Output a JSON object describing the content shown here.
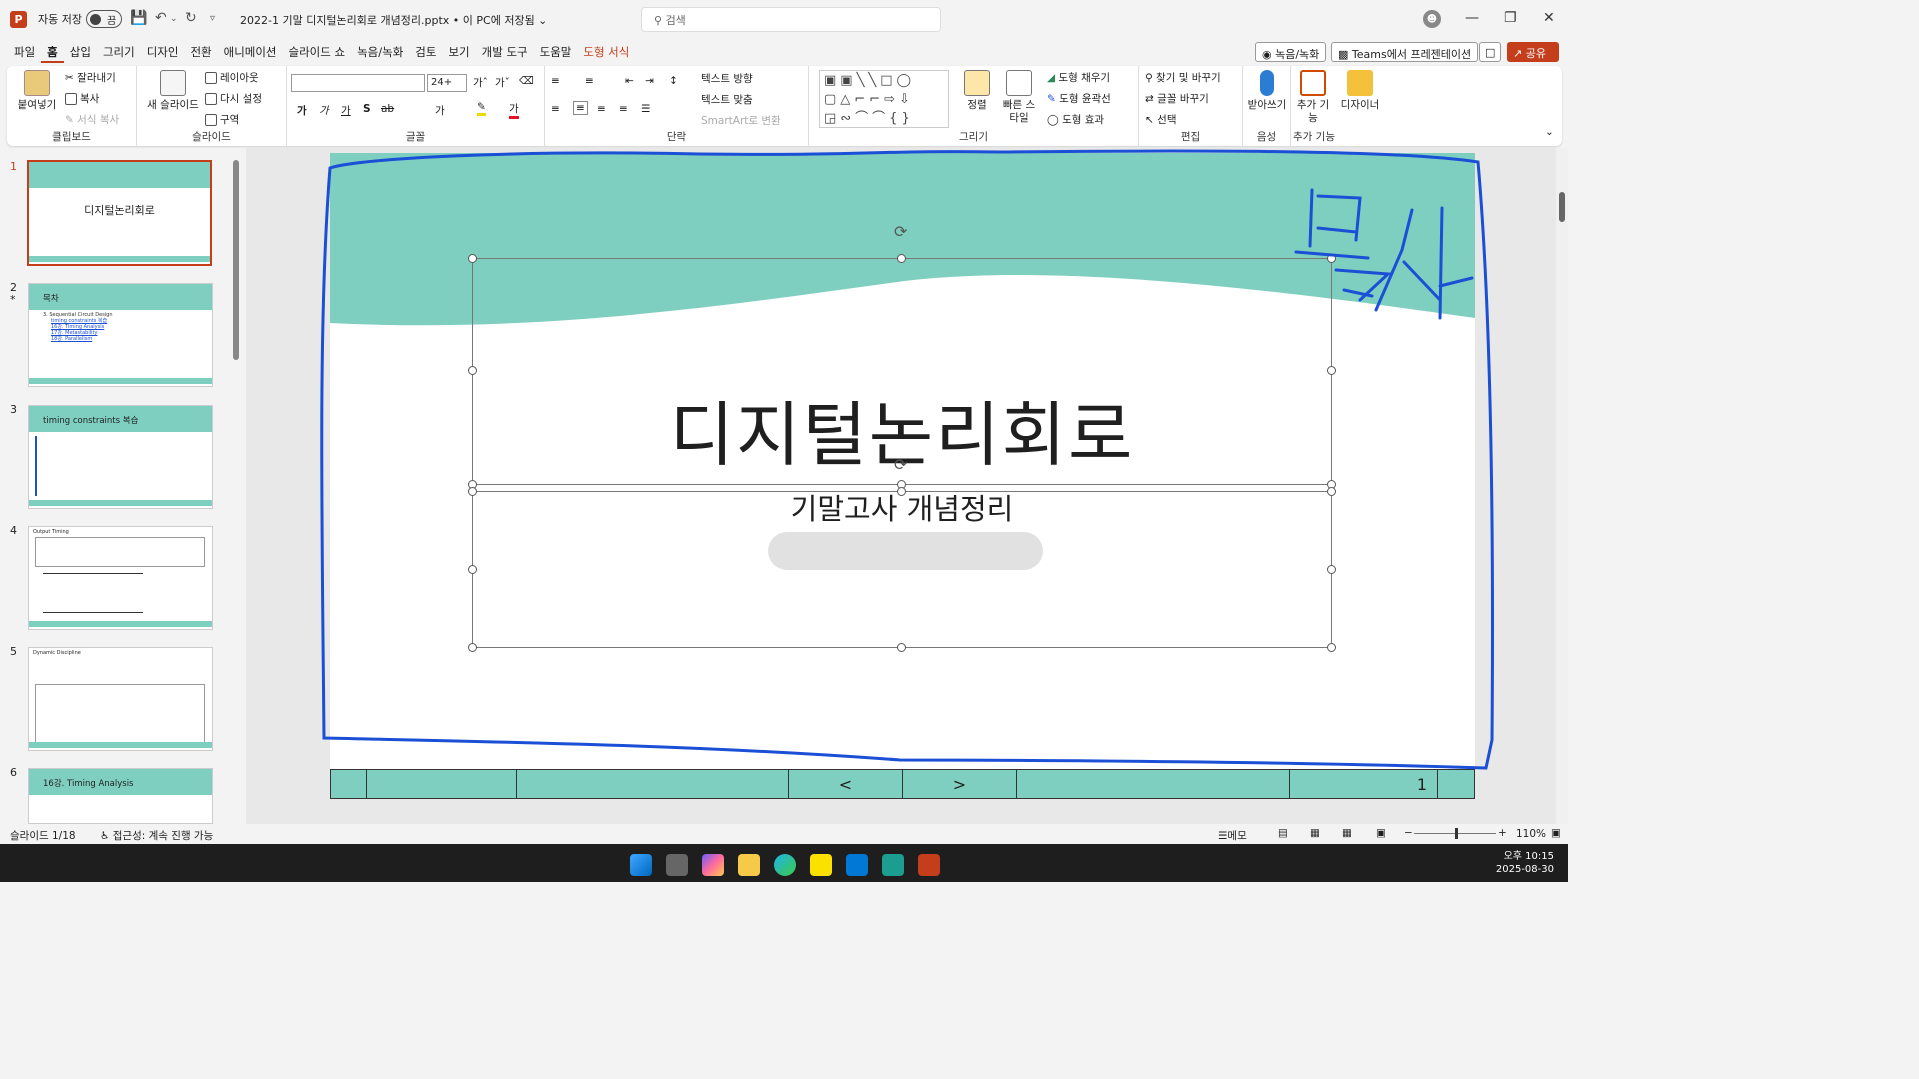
{
  "titlebar": {
    "app_logo": "P",
    "autosave_label": "자동 저장",
    "autosave_state": "끔",
    "document_title": "2022-1 기말 디지털논리회로 개념정리.pptx • 이 PC에 저장됨 ⌄",
    "search_placeholder": "검색"
  },
  "menu": [
    "파일",
    "홈",
    "삽입",
    "그리기",
    "디자인",
    "전환",
    "애니메이션",
    "슬라이드 쇼",
    "녹음/녹화",
    "검토",
    "보기",
    "개발 도구",
    "도움말",
    "도형 서식"
  ],
  "right_buttons": {
    "record": "◉ 녹음/녹화",
    "teams": "Teams에서 프레젠테이션",
    "share": "공유"
  },
  "ribbon": {
    "clipboard": {
      "paste": "붙여넣기",
      "cut": "잘라내기",
      "copy": "복사",
      "format_painter": "서식 복사",
      "label": "클립보드"
    },
    "slides": {
      "new_slide": "새 슬라이드",
      "layout": "레이아웃",
      "reset": "다시 설정",
      "section": "구역",
      "label": "슬라이드"
    },
    "font": {
      "font_name": "",
      "font_size": "24+",
      "label": "글꼴",
      "buttons": [
        "가",
        "가",
        "가",
        "S",
        "ab",
        "가"
      ]
    },
    "paragraph": {
      "text_direction": "텍스트 방향",
      "align_text": "텍스트 맞춤",
      "smartart": "SmartArt로 변환",
      "label": "단락"
    },
    "drawing": {
      "arrange": "정렬",
      "quick_styles": "빠른 스타일",
      "shape_fill": "도형 채우기",
      "shape_outline": "도형 윤곽선",
      "shape_effects": "도형 효과",
      "label": "그리기"
    },
    "editing": {
      "find_replace": "찾기 및 바꾸기",
      "replace_font": "글꼴 바꾸기",
      "select": "선택",
      "label": "편집"
    },
    "voice": {
      "dictate": "받아쓰기",
      "label": "음성"
    },
    "addins": {
      "addins": "추가 기능",
      "designer": "디자이너",
      "label": "추가 기능"
    }
  },
  "thumbnails": [
    {
      "num": "1",
      "title": "디지털논리회로"
    },
    {
      "num": "2",
      "title": "목차",
      "star": "*",
      "lines": [
        "3. Sequential Circuit Design",
        "timing constraints 복습",
        "16강. Timing Analysis",
        "17강. Metastability",
        "18강. Parallelism"
      ]
    },
    {
      "num": "3",
      "title": "timing constraints 복습"
    },
    {
      "num": "4",
      "title": "Output Timing"
    },
    {
      "num": "5",
      "title": "Dynamic Discipline"
    },
    {
      "num": "6",
      "title": "16강. Timing Analysis"
    }
  ],
  "slide": {
    "title": "디지털논리회로",
    "subtitle": "기말고사 개념정리",
    "handwriting": "복사",
    "footer": {
      "prev": "<",
      "next": ">",
      "page": "1"
    }
  },
  "status": {
    "slide_count": "슬라이드 1/18",
    "accessibility": "접근성: 계속 진행 가능",
    "notes": "메모",
    "zoom": "110%"
  },
  "taskbar": {
    "time": "오후 10:15",
    "date": "2025-08-30"
  },
  "colors": {
    "accent": "#c43e1c",
    "teal": "#7fcfc1",
    "ink": "#1a4fd6"
  }
}
